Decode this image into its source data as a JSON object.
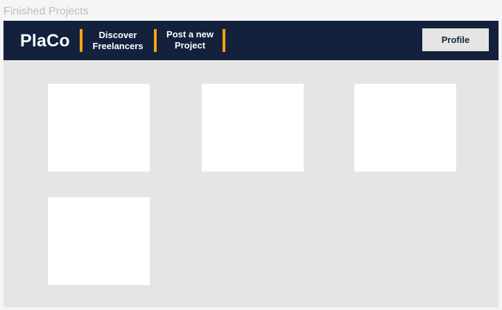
{
  "page": {
    "frame_title": "Finished Projects"
  },
  "navbar": {
    "logo": "PlaCo",
    "links": [
      {
        "line1": "Discover",
        "line2": "Freelancers"
      },
      {
        "line1": "Post a new",
        "line2": "Project"
      }
    ],
    "profile_label": "Profile"
  },
  "projects": {
    "card_count": 4
  },
  "colors": {
    "navbar_bg": "#14213d",
    "accent": "#fca311",
    "content_bg": "#e5e5e5",
    "card_bg": "#ffffff",
    "page_bg": "#f5f5f5",
    "frame_title_text": "#bdbdbd"
  }
}
